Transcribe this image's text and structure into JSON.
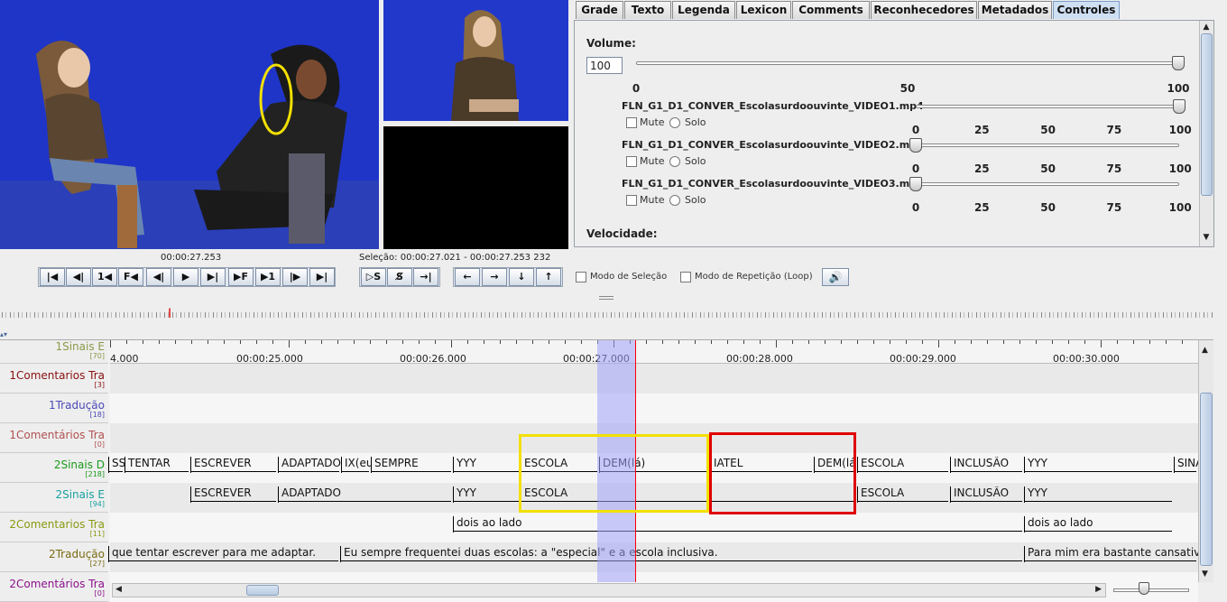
{
  "tabs": [
    "Grade",
    "Texto",
    "Legenda",
    "Lexicon",
    "Comments",
    "Reconhecedores",
    "Metadados",
    "Controles"
  ],
  "controls": {
    "volume_label": "Volume:",
    "volume_value": "100",
    "volume_level": 1.0,
    "scale": [
      "0",
      "50",
      "100"
    ],
    "media": [
      {
        "file": "FLN_G1_D1_CONVER_Escolasurdoouvinte_VIDEO1.mp4",
        "level": 1.0
      },
      {
        "file": "FLN_G1_D1_CONVER_Escolasurdoouvinte_VIDEO2.mp4",
        "level": 0.0
      },
      {
        "file": "FLN_G1_D1_CONVER_Escolasurdoouvinte_VIDEO3.mp4",
        "level": 0.0
      }
    ],
    "mute_label": "Mute",
    "solo_label": "Solo",
    "media_scale": [
      "0",
      "25",
      "50",
      "75",
      "100"
    ],
    "speed_label": "Velocidade:"
  },
  "player": {
    "time": "00:00:27.253",
    "selection": "Seleção: 00:00:27.021 - 00:00:27.253  232",
    "selection_mode": "Modo de Seleção",
    "loop_mode": "Modo de Repetição (Loop)",
    "buttons": [
      "|◀",
      "◀|",
      "1◀",
      "F◀",
      "◀|",
      "▶",
      "▶|",
      "▶F",
      "▶1",
      "|▶",
      "▶|"
    ],
    "sel_buttons": [
      "▷S",
      "S̸",
      "→|"
    ],
    "arrow_buttons": [
      "←",
      "→",
      "↓",
      "↑"
    ]
  },
  "colors": {
    "selection": "#c8c8f8",
    "cursor": "#ff0000",
    "yellow_box": "#f2e000",
    "red_box": "#e00000"
  },
  "timeline": {
    "ticks": [
      "4.000",
      "00:00:25.000",
      "00:00:26.000",
      "00:00:27.000",
      "00:00:28.000",
      "00:00:29.000",
      "00:00:30.000"
    ],
    "tiers": [
      {
        "name": "1Sinais E",
        "count": "[70]",
        "color": "#8a9a4a"
      },
      {
        "name": "1Comentarios Tra",
        "count": "[3]",
        "color": "#8a1010"
      },
      {
        "name": "1Tradução",
        "count": "[18]",
        "color": "#4a4ab8"
      },
      {
        "name": "1Comentários Tra",
        "count": "[0]",
        "color": "#b05050"
      },
      {
        "name": "2Sinais D",
        "count": "[218]",
        "color": "#1a9a1a"
      },
      {
        "name": "2Sinais E",
        "count": "[94]",
        "color": "#1aa0a0"
      },
      {
        "name": "2Comentarios Tra",
        "count": "[11]",
        "color": "#8a9a10"
      },
      {
        "name": "2Tradução",
        "count": "[27]",
        "color": "#7a6a10"
      },
      {
        "name": "2Comentários Tra",
        "count": "[0]",
        "color": "#8a108a"
      }
    ],
    "sinais_d": [
      "SS(",
      "TENTAR",
      "ESCREVER",
      "ADAPTADO",
      "IX(eu)",
      "SEMPRE",
      "YYY",
      "ESCOLA",
      "DEM(lá)",
      "IATEL",
      "DEM(lá",
      "ESCOLA",
      "INCLUSÃO",
      "YYY",
      "SINA"
    ],
    "sinais_e": [
      "ESCREVER",
      "ADAPTADO",
      "YYY",
      "ESCOLA",
      "ESCOLA",
      "INCLUSÃO",
      "YYY"
    ],
    "comentarios": [
      "dois ao lado",
      "dois ao lado"
    ],
    "traducao": [
      "que tentar escrever para me adaptar.",
      "Eu sempre frequentei duas escolas: a \"especial\" e a escola inclusiva.",
      "Para mim era bastante cansativo f"
    ]
  }
}
